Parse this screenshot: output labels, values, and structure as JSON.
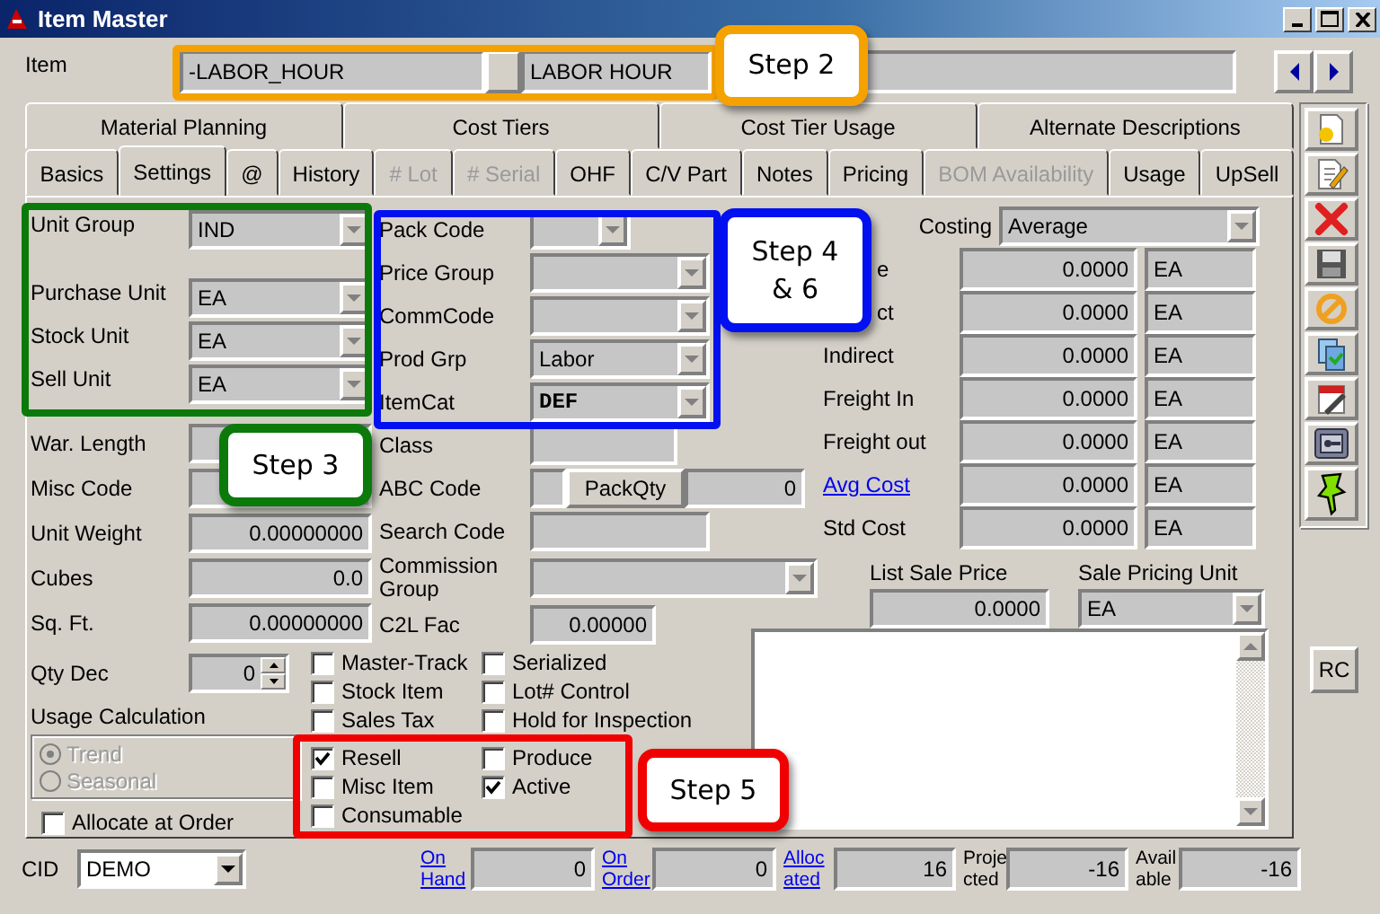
{
  "window": {
    "title": "Item Master"
  },
  "item": {
    "label": "Item",
    "code": "-LABOR_HOUR",
    "description": "LABOR HOUR"
  },
  "tabs_row_1": [
    {
      "label": "Material Planning",
      "selected": false
    },
    {
      "label": "Cost Tiers",
      "selected": false
    },
    {
      "label": "Cost Tier Usage",
      "selected": false
    },
    {
      "label": "Alternate Descriptions",
      "selected": false
    }
  ],
  "tabs_row_2": [
    {
      "label": "Basics",
      "selected": false,
      "disabled": false
    },
    {
      "label": "Settings",
      "selected": true,
      "disabled": false
    },
    {
      "label": "@",
      "selected": false,
      "disabled": false
    },
    {
      "label": "History",
      "selected": false,
      "disabled": false
    },
    {
      "label": "# Lot",
      "selected": false,
      "disabled": true
    },
    {
      "label": "# Serial",
      "selected": false,
      "disabled": true
    },
    {
      "label": "OHF",
      "selected": false,
      "disabled": false
    },
    {
      "label": "C/V Part",
      "selected": false,
      "disabled": false
    },
    {
      "label": "Notes",
      "selected": false,
      "disabled": false
    },
    {
      "label": "Pricing",
      "selected": false,
      "disabled": false
    },
    {
      "label": "BOM Availability",
      "selected": false,
      "disabled": true
    },
    {
      "label": "Usage",
      "selected": false,
      "disabled": false
    },
    {
      "label": "UpSell",
      "selected": false,
      "disabled": false
    }
  ],
  "unit_fields": [
    {
      "label": "Unit Group",
      "value": "IND"
    },
    {
      "label": "Purchase Unit",
      "value": "EA"
    },
    {
      "label": "Stock Unit",
      "value": "EA"
    },
    {
      "label": "Sell Unit",
      "value": "EA"
    }
  ],
  "physical_fields": [
    {
      "label": "War. Length"
    },
    {
      "label": "Misc Code"
    },
    {
      "label": "Unit Weight",
      "value": "0.00000000"
    },
    {
      "label": "Cubes",
      "value": "0.0"
    },
    {
      "label": "Sq. Ft.",
      "value": "0.00000000"
    }
  ],
  "middle_fields": [
    {
      "label": "Pack Code",
      "kind": "combo"
    },
    {
      "label": "Price Group",
      "kind": "combo"
    },
    {
      "label": "CommCode",
      "kind": "combo"
    },
    {
      "label": "Prod Grp",
      "kind": "combo",
      "value": "Labor"
    },
    {
      "label": "ItemCat",
      "kind": "combo",
      "value": "DEF"
    },
    {
      "label": "Class",
      "kind": "text"
    },
    {
      "label": "ABC Code",
      "kind": "abc",
      "button": "PackQty",
      "value": "0"
    },
    {
      "label": "Search Code",
      "kind": "text"
    },
    {
      "label": "Commission Group",
      "kind": "combo"
    },
    {
      "label": "C2L Fac",
      "kind": "text",
      "value": "0.00000"
    }
  ],
  "costing": {
    "label": "Costing",
    "value": "Average"
  },
  "costs": [
    {
      "label": "e",
      "kind": "text",
      "value": "0.0000",
      "unit": "EA"
    },
    {
      "label": "ct",
      "kind": "text",
      "value": "0.0000",
      "unit": "EA"
    },
    {
      "label": "Indirect",
      "kind": "text",
      "value": "0.0000",
      "unit": "EA"
    },
    {
      "label": "Freight In",
      "kind": "text",
      "value": "0.0000",
      "unit": "EA"
    },
    {
      "label": "Freight out",
      "kind": "text",
      "value": "0.0000",
      "unit": "EA"
    },
    {
      "label": "Avg Cost",
      "kind": "link",
      "value": "0.0000",
      "unit": "EA"
    },
    {
      "label": "Std Cost",
      "kind": "text",
      "value": "0.0000",
      "unit": "EA"
    }
  ],
  "list_sale_price": {
    "label": "List Sale Price",
    "value": "0.0000"
  },
  "sale_pricing_unit": {
    "label": "Sale Pricing Unit",
    "value": "EA"
  },
  "qty_dec": {
    "label": "Qty Dec",
    "value": "0"
  },
  "usage_calculation": {
    "label": "Usage Calculation",
    "disabled": true,
    "options": [
      {
        "label": "Trend",
        "selected": true
      },
      {
        "label": "Seasonal",
        "selected": false
      }
    ]
  },
  "allocate_at_order": {
    "label": "Allocate at Order",
    "checked": false
  },
  "flags": [
    {
      "label": "Master-Track",
      "checked": false
    },
    {
      "label": "Serialized",
      "checked": false
    },
    {
      "label": "Stock Item",
      "checked": false
    },
    {
      "label": "Lot# Control",
      "checked": false
    },
    {
      "label": "Sales Tax",
      "checked": false
    },
    {
      "label": "Hold for Inspection",
      "checked": false
    },
    {
      "label": "Resell",
      "checked": true
    },
    {
      "label": "Produce",
      "checked": false
    },
    {
      "label": "Misc Item",
      "checked": false
    },
    {
      "label": "Active",
      "checked": true
    },
    {
      "label": "Consumable",
      "checked": false
    }
  ],
  "rc_button": "RC",
  "cid": {
    "label": "CID",
    "value": "DEMO"
  },
  "stock": [
    {
      "lines": [
        "On",
        "Hand"
      ],
      "kind": "link",
      "value": "0"
    },
    {
      "lines": [
        "On",
        "Order"
      ],
      "kind": "link",
      "value": "0"
    },
    {
      "lines": [
        "Alloc",
        "ated"
      ],
      "kind": "link",
      "value": "16"
    },
    {
      "lines": [
        "Proje",
        "cted"
      ],
      "kind": "text",
      "value": "-16"
    },
    {
      "lines": [
        "Avail",
        "able"
      ],
      "kind": "text",
      "value": "-16"
    }
  ],
  "annotations": [
    {
      "label": "Step 2",
      "color": "#f5a200"
    },
    {
      "label": "Step 3",
      "color": "#0b7a0b"
    },
    {
      "label": "Step 4 & 6",
      "color": "#0010f0"
    },
    {
      "label": "Step 5",
      "color": "#f00000"
    }
  ]
}
